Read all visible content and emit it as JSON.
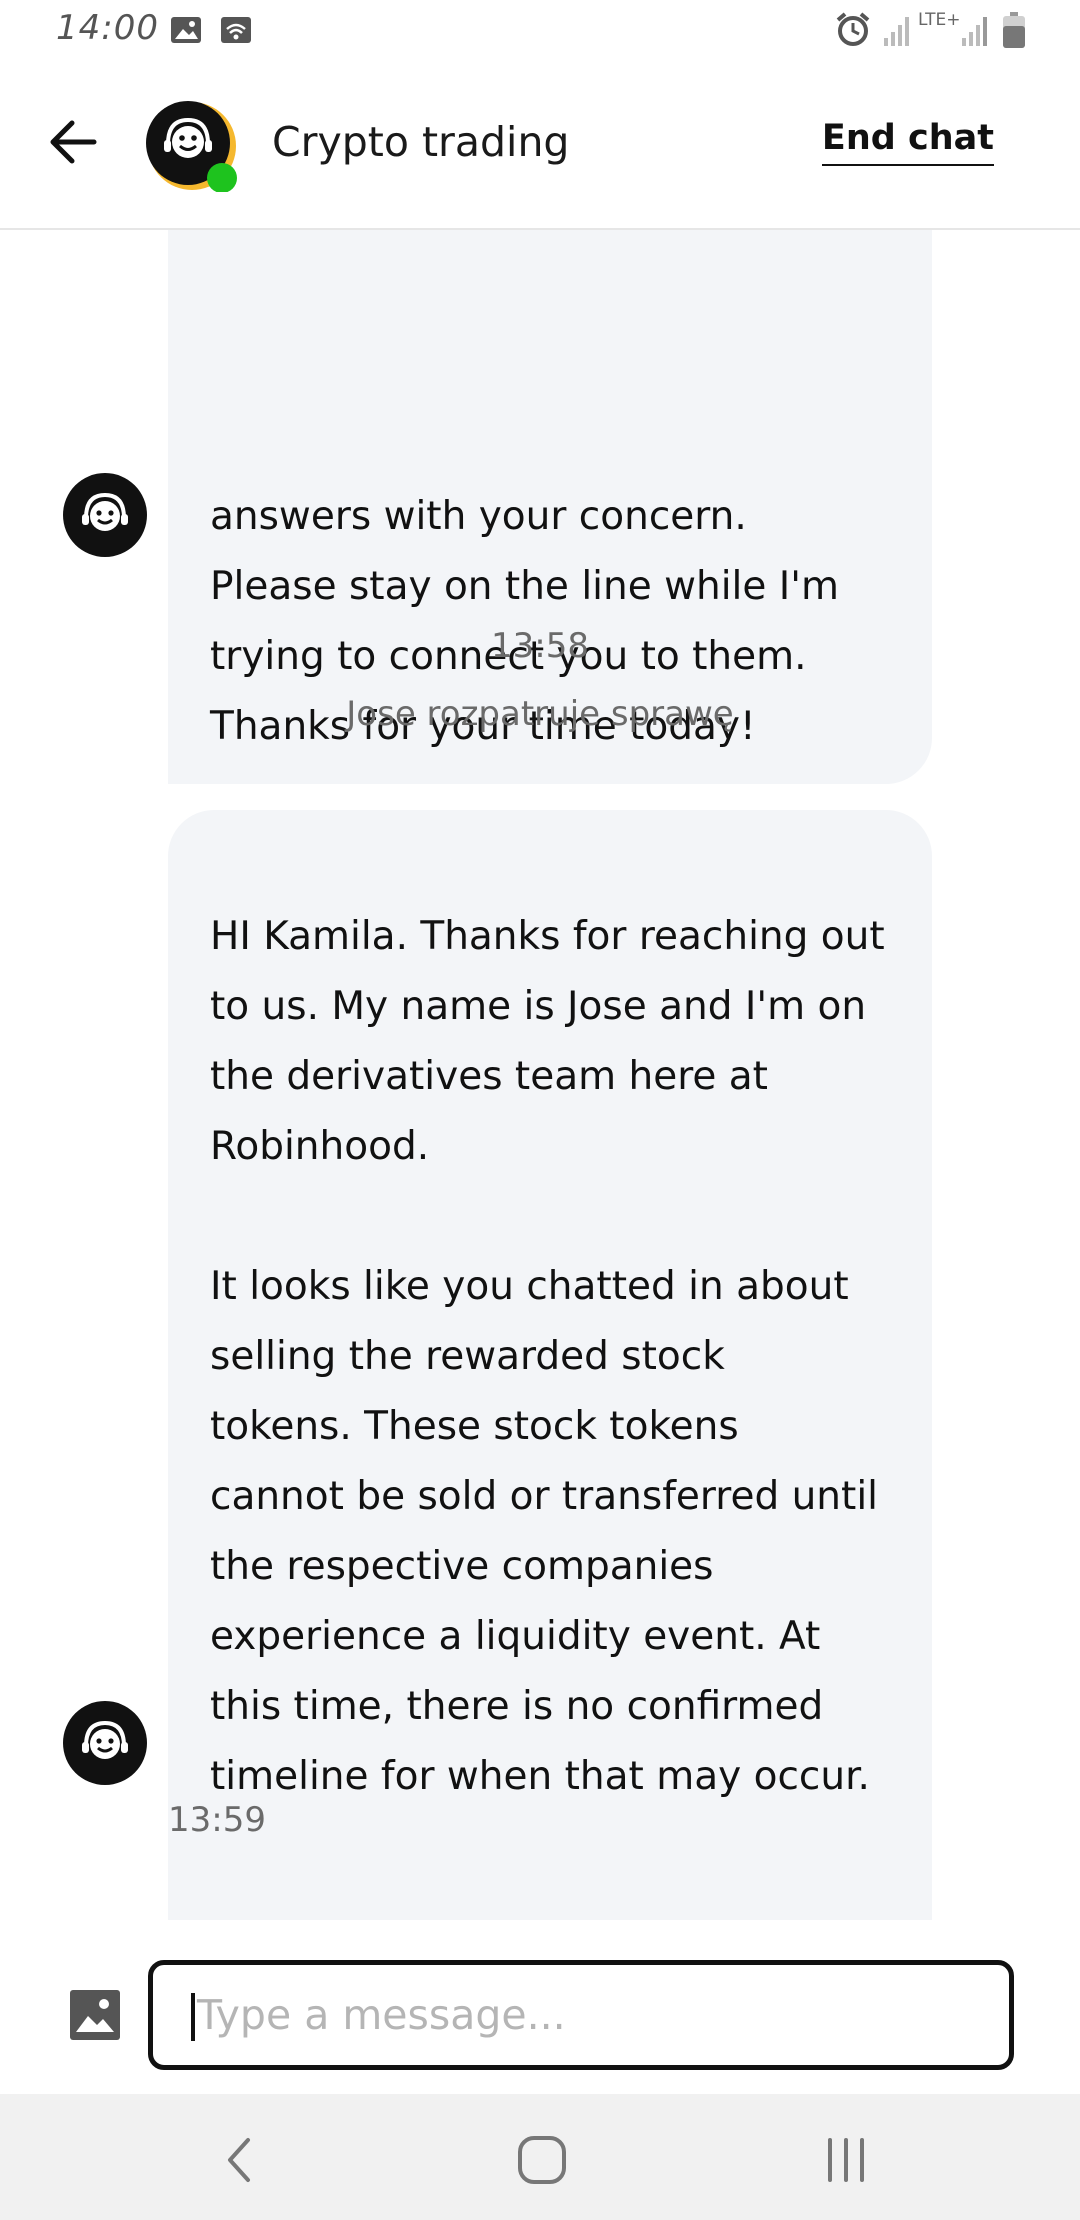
{
  "status_bar": {
    "time": "14:00",
    "network_label": "LTE+",
    "icons": [
      "image-icon",
      "wifi-calling-icon",
      "alarm-icon",
      "signal-icon",
      "battery-icon"
    ]
  },
  "header": {
    "title": "Crypto trading",
    "end_chat_label": "End chat",
    "online_color": "#1ec31e",
    "avatar_ring_color": "#f5b82e"
  },
  "messages": [
    {
      "sender": "agent",
      "text": "answers with your concern.\nPlease stay on the line while I'm\ntrying to connect you to them.\nThanks for your time today!"
    },
    {
      "sender": "agent",
      "text": "HI Kamila. Thanks for reaching out\nto us. My name is Jose and I'm on\nthe derivatives team here at\nRobinhood.\n\nIt looks like you chatted in about\nselling the rewarded stock\ntokens. These stock tokens\ncannot be sold or transferred until\nthe respective companies\nexperience a liquidity event. At\nthis time, there is no confirmed\ntimeline for when that may occur.",
      "time": "13:59"
    }
  ],
  "system_notice": {
    "time": "13:58",
    "text": "Jose rozpatruje sprawę"
  },
  "composer": {
    "placeholder": "Type a message..."
  },
  "nav": [
    "back-icon",
    "home-icon",
    "recents-icon"
  ]
}
